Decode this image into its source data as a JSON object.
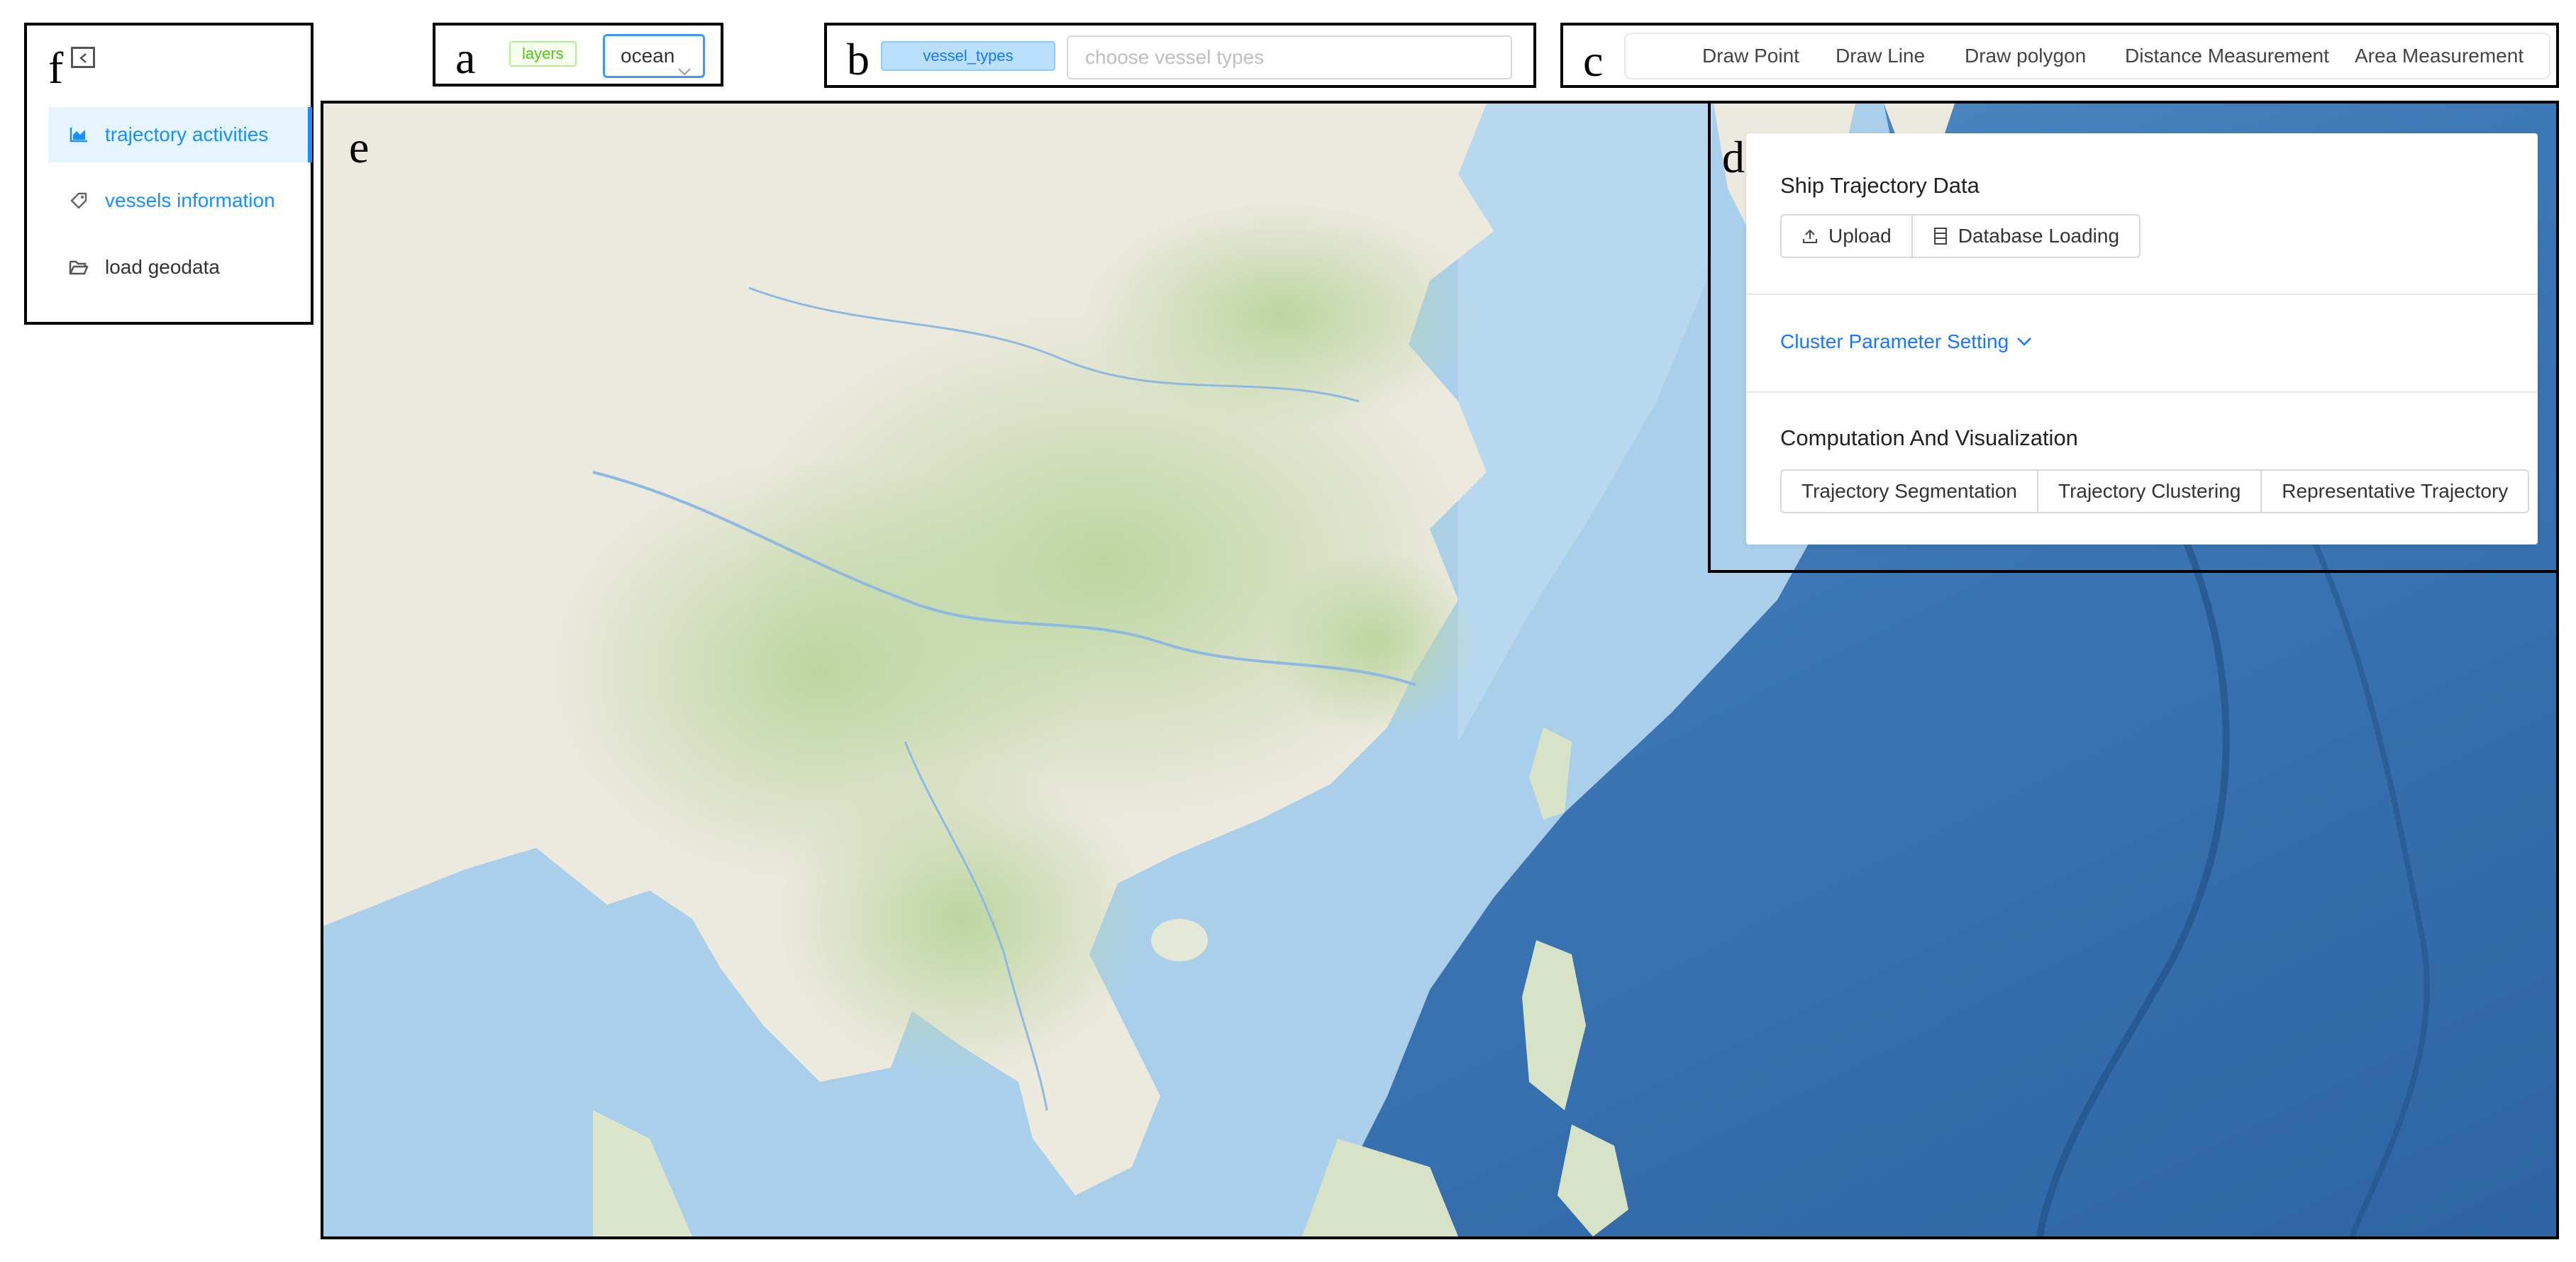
{
  "panels": {
    "a": "a",
    "b": "b",
    "c": "c",
    "d": "d",
    "e": "e",
    "f": "f"
  },
  "sidebar": {
    "items": [
      {
        "label": "trajectory activities",
        "icon": "area-chart-icon",
        "state": "active"
      },
      {
        "label": "vessels information",
        "icon": "tag-icon"
      },
      {
        "label": "load geodata",
        "icon": "folder-open-icon"
      }
    ]
  },
  "layers": {
    "tag": "layers",
    "selected": "ocean"
  },
  "vessel": {
    "tag": "vessel_types",
    "placeholder": "choose vessel types"
  },
  "tools": [
    "Draw Point",
    "Draw Line",
    "Draw polygon",
    "Distance Measurement",
    "Area Measurement"
  ],
  "control": {
    "ship_title": "Ship Trajectory Data",
    "upload": "Upload",
    "db_loading": "Database Loading",
    "cluster_setting": "Cluster Parameter Setting",
    "compute_title": "Computation And Visualization",
    "segmentation": "Trajectory Segmentation",
    "clustering": "Trajectory Clustering",
    "representative": "Representative Trajectory"
  },
  "colors": {
    "accent": "#1890ff",
    "land": "#eceadf",
    "land_green": "#c9ddb0",
    "ocean": "#a7cdea",
    "deep_ocean": "#3f7cb8"
  }
}
